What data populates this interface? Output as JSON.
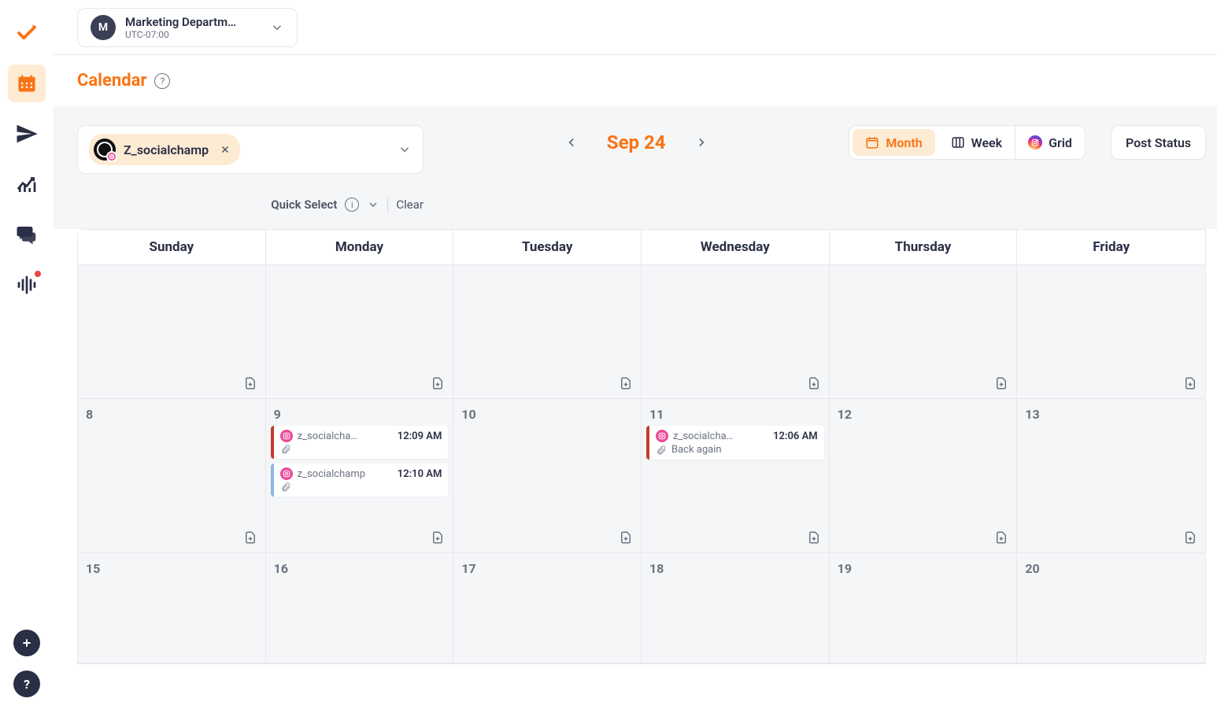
{
  "workspace": {
    "avatar_initial": "M",
    "name": "Marketing Departm…",
    "timezone": "UTC-07:00"
  },
  "page": {
    "title": "Calendar"
  },
  "filter": {
    "account_chip": "Z_socialchamp",
    "quick_select": "Quick Select",
    "clear": "Clear"
  },
  "month_nav": {
    "label": "Sep 24"
  },
  "view_toggle": {
    "month": "Month",
    "week": "Week",
    "grid": "Grid"
  },
  "post_status_btn": "Post Status",
  "day_headers": [
    "Sunday",
    "Monday",
    "Tuesday",
    "Wednesday",
    "Thursday",
    "Friday"
  ],
  "weeks": [
    {
      "days": [
        {
          "num": ""
        },
        {
          "num": ""
        },
        {
          "num": ""
        },
        {
          "num": ""
        },
        {
          "num": ""
        },
        {
          "num": ""
        }
      ]
    },
    {
      "days": [
        {
          "num": "8"
        },
        {
          "num": "9",
          "events": [
            {
              "bar": "red",
              "account": "z_socialcha…",
              "time": "12:09 AM",
              "caption": ""
            },
            {
              "bar": "blue",
              "account": "z_socialchamp",
              "time": "12:10 AM",
              "caption": ""
            }
          ]
        },
        {
          "num": "10"
        },
        {
          "num": "11",
          "events": [
            {
              "bar": "red",
              "account": "z_socialcha…",
              "time": "12:06 AM",
              "caption": "Back again"
            }
          ]
        },
        {
          "num": "12"
        },
        {
          "num": "13"
        }
      ]
    },
    {
      "days": [
        {
          "num": "15"
        },
        {
          "num": "16"
        },
        {
          "num": "17"
        },
        {
          "num": "18"
        },
        {
          "num": "19"
        },
        {
          "num": "20"
        }
      ]
    }
  ]
}
